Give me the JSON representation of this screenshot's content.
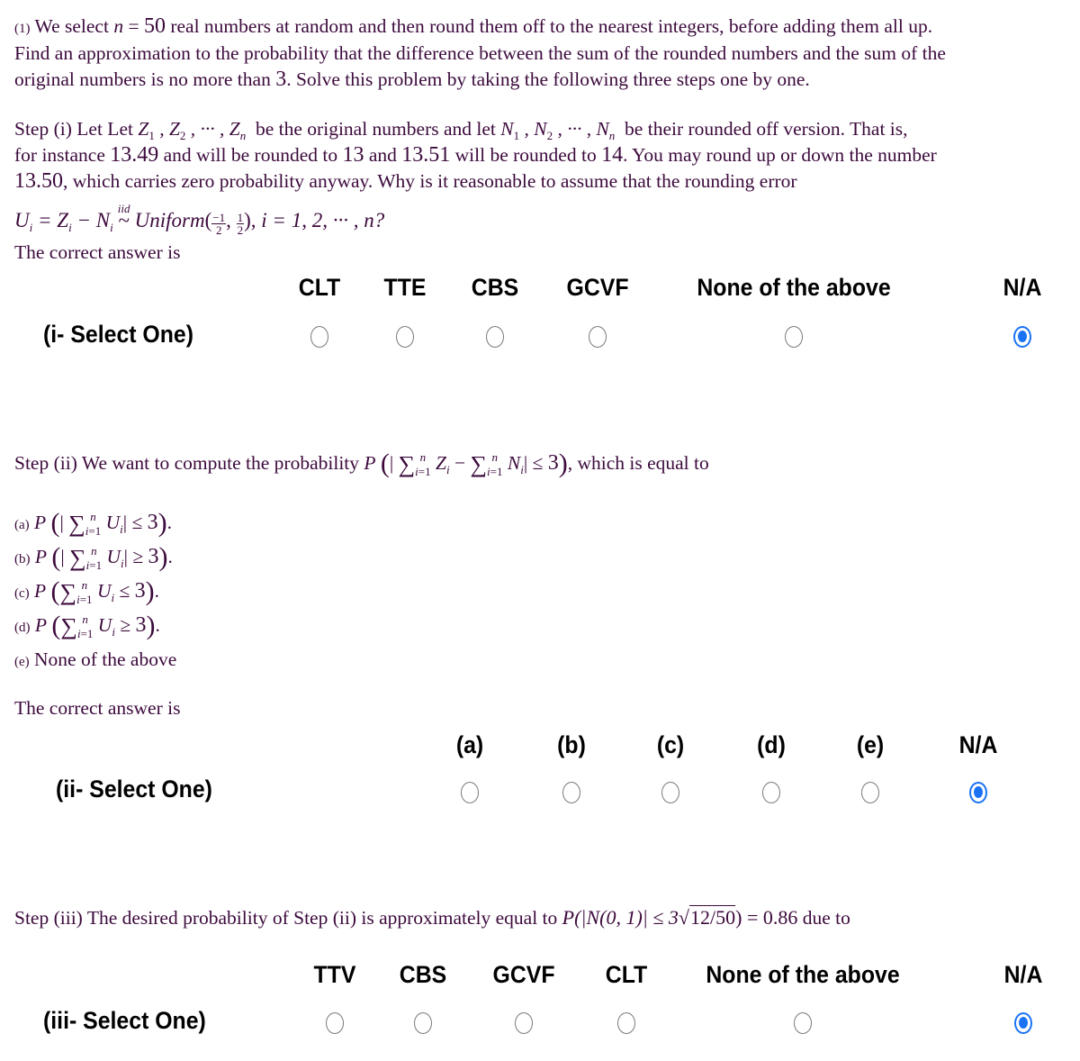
{
  "problem": {
    "line1_prefix": "We select",
    "n_var": "n",
    "n_eq": "=",
    "n_value": "50",
    "line1_suffix": "real numbers at random and then round them off to the nearest integers, before adding them all up.",
    "num_label": "(1)",
    "line2": "Find an approximation to the probability that the difference between the sum of the rounded numbers and the sum of the",
    "line3_prefix": "original numbers is no more than",
    "line3_value": "3",
    "line3_suffix": ". Solve this problem by taking the following three steps one by one."
  },
  "step1": {
    "label": "Step (i)",
    "text_a": "Let Let",
    "z_seq": "Z",
    "text_b": "be the original numbers and let",
    "n_seq": "N",
    "text_c": "be their rounded off version. That is,",
    "line2_a": "for instance",
    "v1": "13.49",
    "line2_b": "and will be rounded to",
    "v2": "13",
    "line2_c": "and",
    "v3": "13.51",
    "line2_d": "will be rounded to",
    "v4": "14",
    "line2_e": ". You may round up or down the number",
    "v5": "13.50",
    "line3": ", which carries zero probability anyway. Why is it reasonable to assume that the rounding error",
    "formula_iid": "iid",
    "formula_dist": "Uniform",
    "formula_tail": ", i = 1, 2, ··· , n?",
    "answer_prompt": "The correct answer is",
    "row_label": "(i- Select One)",
    "options": [
      "CLT",
      "TTE",
      "CBS",
      "GCVF",
      "None of the above",
      "N/A"
    ],
    "selected": "N/A"
  },
  "step2": {
    "label": "Step (ii)",
    "text": "We want to compute the probability",
    "text_tail": ", which is equal to",
    "choices": [
      {
        "key": "(a)",
        "abs": true,
        "op": "≤"
      },
      {
        "key": "(b)",
        "abs": true,
        "op": "≥"
      },
      {
        "key": "(c)",
        "abs": false,
        "op": "≤"
      },
      {
        "key": "(d)",
        "abs": false,
        "op": "≥"
      }
    ],
    "choice_e": "None of the above",
    "choice_e_key": "(e)",
    "bound": "3",
    "answer_prompt": "The correct answer is",
    "row_label": "(ii- Select One)",
    "options": [
      "(a)",
      "(b)",
      "(c)",
      "(d)",
      "(e)",
      "N/A"
    ],
    "selected": "N/A"
  },
  "step3": {
    "label": "Step (iii)",
    "text": "The desired probability of Step (ii) is approximately equal to",
    "formula_left": "P(|N(0, 1)| ≤ 3",
    "sqrt_arg": "12/50",
    "formula_right": ") = 0.86",
    "text_tail": "due to",
    "row_label": "(iii- Select One)",
    "options": [
      "TTV",
      "CBS",
      "GCVF",
      "CLT",
      "None of the above",
      "N/A"
    ],
    "selected": "N/A"
  },
  "colors": {
    "text": "#3c0a3c",
    "radio_selected": "#1a73f5",
    "radio_border": "#7a7a7a"
  }
}
